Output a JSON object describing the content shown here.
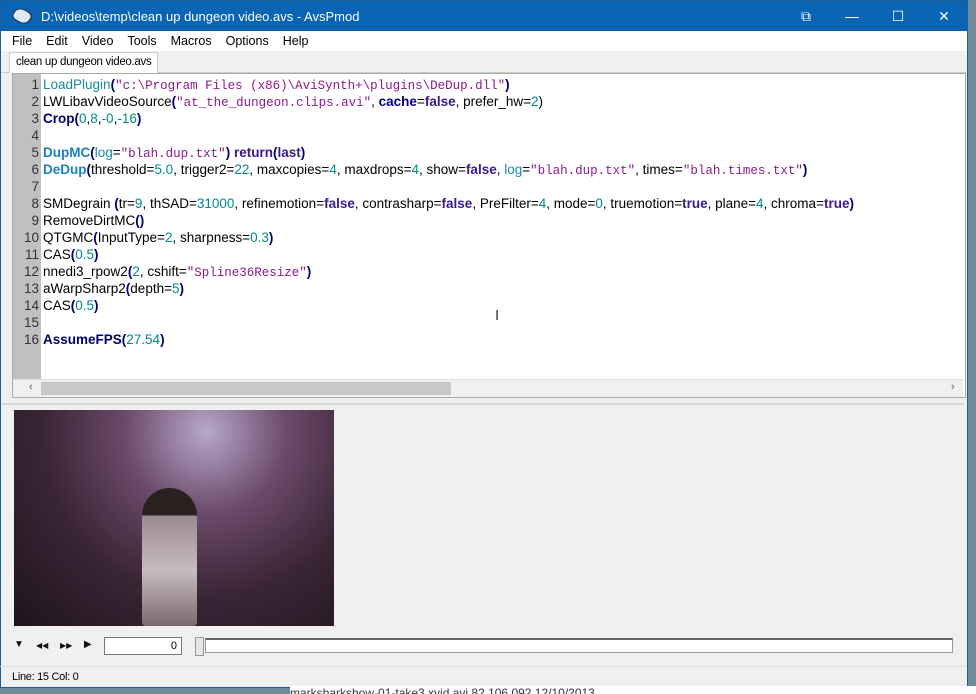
{
  "window": {
    "title": "D:\\videos\\temp\\clean up dungeon video.avs - AvsPmod",
    "minimize": "—",
    "maximize": "☐",
    "close": "✕",
    "restore_icon": "⧉"
  },
  "menu": [
    "File",
    "Edit",
    "Video",
    "Tools",
    "Macros",
    "Options",
    "Help"
  ],
  "tab": "clean up dungeon video.avs",
  "code": [
    [
      [
        "lp",
        "LoadPlugin"
      ],
      [
        "fn",
        "("
      ],
      [
        "str",
        "\"c:\\Program Files (x86)\\AviSynth+\\plugins\\DeDup.dll\""
      ],
      [
        "fn",
        ")"
      ]
    ],
    [
      [
        "",
        "LWLibavVideoSource"
      ],
      [
        "fn",
        "("
      ],
      [
        "str",
        "\"at_the_dungeon.clips.avi\""
      ],
      [
        "",
        ", "
      ],
      [
        "fn",
        "cache"
      ],
      [
        "",
        "="
      ],
      [
        "kw",
        "false"
      ],
      [
        "",
        ", prefer_hw="
      ],
      [
        "num",
        "2"
      ],
      [
        "",
        ")"
      ]
    ],
    [
      [
        "fn",
        "Crop"
      ],
      [
        "fn",
        "("
      ],
      [
        "num",
        "0"
      ],
      [
        "",
        ","
      ],
      [
        "num",
        "8"
      ],
      [
        "",
        ","
      ],
      [
        "num",
        "-0"
      ],
      [
        "",
        ","
      ],
      [
        "num",
        "-16"
      ],
      [
        "fn",
        ")"
      ]
    ],
    [],
    [
      [
        "fn2",
        "DupMC"
      ],
      [
        "fn",
        "("
      ],
      [
        "arg",
        "log"
      ],
      [
        "",
        "="
      ],
      [
        "str",
        "\"blah.dup.txt\""
      ],
      [
        "fn",
        ")"
      ],
      [
        "",
        ""
      ],
      [
        "kw",
        " return"
      ],
      [
        "fn",
        "("
      ],
      [
        "kw",
        "last"
      ],
      [
        "fn",
        ")"
      ]
    ],
    [
      [
        "fn2",
        "DeDup"
      ],
      [
        "fn",
        "("
      ],
      [
        "",
        "threshold="
      ],
      [
        "num",
        "5.0"
      ],
      [
        "",
        ", trigger2="
      ],
      [
        "num",
        "22"
      ],
      [
        "",
        ", maxcopies="
      ],
      [
        "num",
        "4"
      ],
      [
        "",
        ", maxdrops="
      ],
      [
        "num",
        "4"
      ],
      [
        "",
        ", show="
      ],
      [
        "kw",
        "false"
      ],
      [
        "",
        ", "
      ],
      [
        "arg",
        "log"
      ],
      [
        "",
        "="
      ],
      [
        "str",
        "\"blah.dup.txt\""
      ],
      [
        "",
        ", times="
      ],
      [
        "str",
        "\"blah.times.txt\""
      ],
      [
        "fn",
        ")"
      ]
    ],
    [],
    [
      [
        "",
        "SMDegrain "
      ],
      [
        "fn",
        "("
      ],
      [
        "",
        "tr="
      ],
      [
        "num",
        "9"
      ],
      [
        "",
        ", thSAD="
      ],
      [
        "num",
        "31000"
      ],
      [
        "",
        ", refinemotion="
      ],
      [
        "kw",
        "false"
      ],
      [
        "",
        ", contrasharp="
      ],
      [
        "kw",
        "false"
      ],
      [
        "",
        ", PreFilter="
      ],
      [
        "num",
        "4"
      ],
      [
        "",
        ", mode="
      ],
      [
        "num",
        "0"
      ],
      [
        "",
        ", truemotion="
      ],
      [
        "kw",
        "true"
      ],
      [
        "",
        ", plane="
      ],
      [
        "num",
        "4"
      ],
      [
        "",
        ", chroma="
      ],
      [
        "kw",
        "true"
      ],
      [
        "fn",
        ")"
      ]
    ],
    [
      [
        "",
        "RemoveDirtMC"
      ],
      [
        "fn",
        "()"
      ]
    ],
    [
      [
        "",
        "QTGMC"
      ],
      [
        "fn",
        "("
      ],
      [
        "",
        "InputType="
      ],
      [
        "num",
        "2"
      ],
      [
        "",
        ", sharpness="
      ],
      [
        "num",
        "0.3"
      ],
      [
        "fn",
        ")"
      ]
    ],
    [
      [
        "",
        "CAS"
      ],
      [
        "fn",
        "("
      ],
      [
        "num",
        "0.5"
      ],
      [
        "fn",
        ")"
      ]
    ],
    [
      [
        "",
        "nnedi3_rpow2"
      ],
      [
        "fn",
        "("
      ],
      [
        "num",
        "2"
      ],
      [
        "",
        ", cshift="
      ],
      [
        "str",
        "\"Spline36Resize\""
      ],
      [
        "fn",
        ")"
      ]
    ],
    [
      [
        "",
        "aWarpSharp2"
      ],
      [
        "fn",
        "("
      ],
      [
        "",
        "depth="
      ],
      [
        "num",
        "5"
      ],
      [
        "fn",
        ")"
      ]
    ],
    [
      [
        "",
        "CAS"
      ],
      [
        "fn",
        "("
      ],
      [
        "num",
        "0.5"
      ],
      [
        "fn",
        ")"
      ]
    ],
    [],
    [
      [
        "fn",
        "AssumeFPS"
      ],
      [
        "fn",
        "("
      ],
      [
        "num",
        "27.54"
      ],
      [
        "fn",
        ")"
      ]
    ]
  ],
  "controls": {
    "frame": "0",
    "down": "▼",
    "prev": "◀◀",
    "next": "▶▶",
    "play": "▶"
  },
  "status": "Line: 15  Col: 0",
  "desktop_row": "marksbarkshow-01-take3.xvid      avi      82,106,092   12/10/2013"
}
